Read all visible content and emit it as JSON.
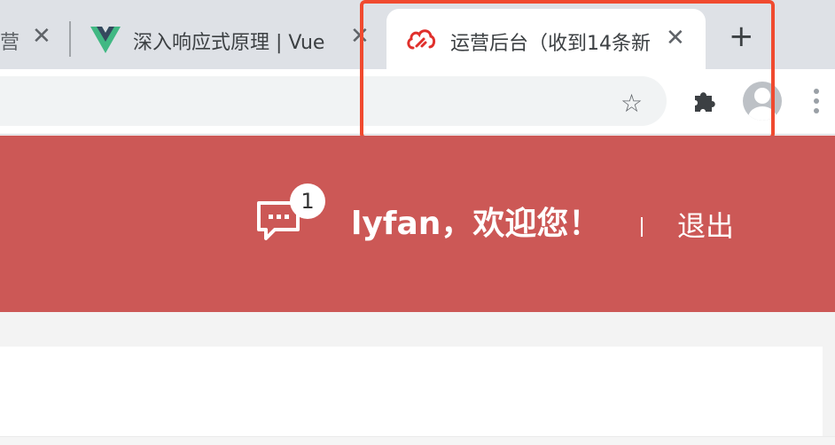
{
  "browser": {
    "tabs": [
      {
        "title": "营",
        "active": false
      },
      {
        "title": "深入响应式原理 | Vue",
        "icon": "vue-logo-icon",
        "active": false
      },
      {
        "title": "运营后台（收到14条新",
        "icon": "cloud-logo-icon",
        "active": true
      }
    ],
    "close_glyph": "✕",
    "new_tab_glyph": "+",
    "star_glyph": "☆"
  },
  "header": {
    "message_badge_count": "1",
    "welcome": "lyfan，欢迎您！",
    "logout": "退出"
  },
  "colors": {
    "header_bg": "#cc5856",
    "highlight": "#f04a2f",
    "tab_strip": "#dee1e6",
    "vue_green": "#41b883",
    "vue_dark": "#35495e"
  }
}
